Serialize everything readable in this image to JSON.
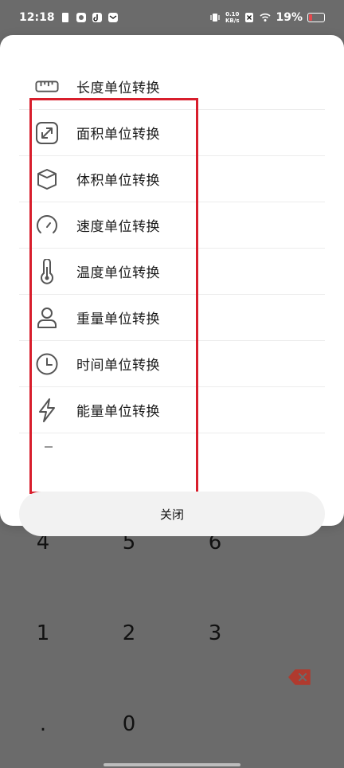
{
  "status_bar": {
    "time": "12:18",
    "net_speed_top": "0.10",
    "net_speed_bottom": "KB/s",
    "battery_percent": "19%",
    "icons": [
      "sim-card-icon",
      "app-notification-icon",
      "tiktok-icon",
      "mail-icon",
      "vibrate-icon",
      "no-sim-icon",
      "wifi-icon",
      "battery-icon"
    ]
  },
  "menu": {
    "items": [
      {
        "label": "长度单位转换",
        "icon": "ruler-icon"
      },
      {
        "label": "面积单位转换",
        "icon": "area-expand-icon"
      },
      {
        "label": "体积单位转换",
        "icon": "cylinder-icon"
      },
      {
        "label": "速度单位转换",
        "icon": "speedometer-icon"
      },
      {
        "label": "温度单位转换",
        "icon": "thermometer-icon"
      },
      {
        "label": "重量单位转换",
        "icon": "weight-icon"
      },
      {
        "label": "时间单位转换",
        "icon": "clock-icon"
      },
      {
        "label": "能量单位转换",
        "icon": "lightning-icon"
      }
    ],
    "close_label": "关闭",
    "highlight_color": "#d81e2c"
  },
  "keypad": {
    "row1": [
      "4",
      "5",
      "6"
    ],
    "row2": [
      "1",
      "2",
      "3"
    ],
    "row3": [
      ".",
      "0"
    ],
    "backspace_color": "#c0392b"
  }
}
